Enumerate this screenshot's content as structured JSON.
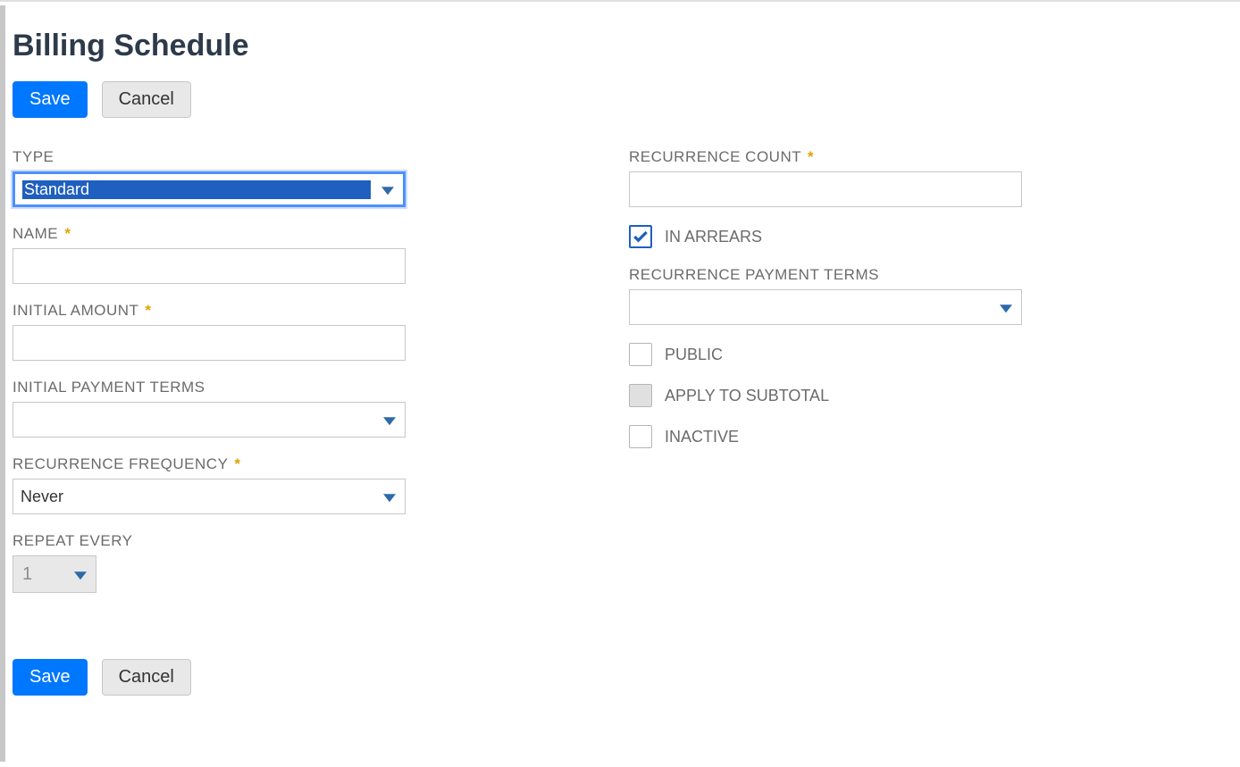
{
  "page": {
    "title": "Billing Schedule"
  },
  "buttons": {
    "save": "Save",
    "cancel": "Cancel"
  },
  "left": {
    "type_label": "TYPE",
    "type_value": "Standard",
    "name_label": "NAME",
    "name_value": "",
    "initial_amount_label": "INITIAL AMOUNT",
    "initial_amount_value": "",
    "initial_payment_terms_label": "INITIAL PAYMENT TERMS",
    "initial_payment_terms_value": "",
    "recurrence_frequency_label": "RECURRENCE FREQUENCY",
    "recurrence_frequency_value": "Never",
    "repeat_every_label": "REPEAT EVERY",
    "repeat_every_value": "1"
  },
  "right": {
    "recurrence_count_label": "RECURRENCE COUNT",
    "recurrence_count_value": "",
    "in_arrears_label": "IN ARREARS",
    "in_arrears_checked": true,
    "recurrence_payment_terms_label": "RECURRENCE PAYMENT TERMS",
    "recurrence_payment_terms_value": "",
    "public_label": "PUBLIC",
    "public_checked": false,
    "apply_to_subtotal_label": "APPLY TO SUBTOTAL",
    "apply_to_subtotal_checked": false,
    "apply_to_subtotal_disabled": true,
    "inactive_label": "INACTIVE",
    "inactive_checked": false
  }
}
